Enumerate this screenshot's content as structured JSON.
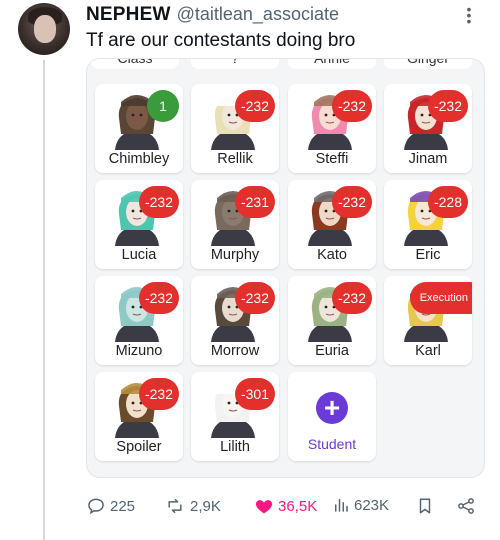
{
  "tweet": {
    "display_name": "NEPHEW",
    "handle": "@taitlean_associate",
    "text": "Tf are our contestants doing bro",
    "more_icon": "more-dots-icon"
  },
  "media": {
    "top_row_labels": [
      "Class",
      "?",
      "Annie",
      "Ginger"
    ],
    "cards": [
      {
        "name": "Chimbley",
        "badge": "1",
        "badge_color": "#3a9b3a",
        "hair": "#5a4537",
        "hat": "#4b3a2f",
        "skin": "#7a5a44"
      },
      {
        "name": "Rellik",
        "badge": "-232",
        "badge_color": "#e3302d",
        "hair": "#e9e0b8",
        "hat": "#ffffff",
        "skin": "#f3e7dc"
      },
      {
        "name": "Steffi",
        "badge": "-232",
        "badge_color": "#e3302d",
        "hair": "#f08bb0",
        "hat": "#a3745f",
        "skin": "#f8dcd2"
      },
      {
        "name": "Jinam",
        "badge": "-232",
        "badge_color": "#e3302d",
        "hair": "#c8262a",
        "hat": "#c8262a",
        "skin": "#f3e2d3"
      },
      {
        "name": "Lucia",
        "badge": "-232",
        "badge_color": "#e3302d",
        "hair": "#4fc5b0",
        "hat": "#4fc5b0",
        "skin": "#f1e6df"
      },
      {
        "name": "Murphy",
        "badge": "-231",
        "badge_color": "#e3302d",
        "hair": "#7a6a5e",
        "hat": "#6b5d52",
        "skin": "#8b7b6e"
      },
      {
        "name": "Kato",
        "badge": "-232",
        "badge_color": "#e3302d",
        "hair": "#8a3a1e",
        "hat": "#6e6e6e",
        "skin": "#f0d8c6"
      },
      {
        "name": "Eric",
        "badge": "-228",
        "badge_color": "#e3302d",
        "hair": "#f3d23c",
        "hat": "#7a4ab8",
        "skin": "#f6e7d6"
      },
      {
        "name": "Mizuno",
        "badge": "-232",
        "badge_color": "#e3302d",
        "hair": "#8ec9c6",
        "hat": "#8ec9c6",
        "skin": "#cfe5e3"
      },
      {
        "name": "Morrow",
        "badge": "-232",
        "badge_color": "#e3302d",
        "hair": "#5a4a3c",
        "hat": "#6a6259",
        "skin": "#eadbd0"
      },
      {
        "name": "Euria",
        "badge": "-232",
        "badge_color": "#e3302d",
        "hair": "#9bb285",
        "hat": "#9bb285",
        "skin": "#eee6d9"
      },
      {
        "name": "Karl",
        "badge": "Execution",
        "badge_color": "#e3302d",
        "hair": "#e7c84f",
        "hat": "#3a3a3a",
        "skin": "#f4e3c9"
      },
      {
        "name": "Spoiler",
        "badge": "-232",
        "badge_color": "#e3302d",
        "hair": "#6a4b2a",
        "hat": "#b78d3d",
        "skin": "#f0e0cc"
      },
      {
        "name": "Lilith",
        "badge": "-301",
        "badge_color": "#e3302d",
        "hair": "#f2f2f2",
        "hat": "#ffffff",
        "skin": "#fbf5f2"
      }
    ],
    "add_card": {
      "label": "Student",
      "icon": "plus-icon",
      "color": "#6a3bd8"
    }
  },
  "actions": {
    "replies": "225",
    "reposts": "2,9K",
    "likes": "36,5K",
    "views": "623K",
    "like_color": "#f91880"
  }
}
